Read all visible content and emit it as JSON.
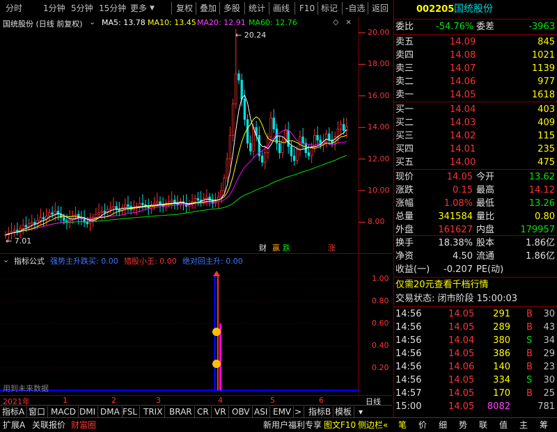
{
  "toolbar": {
    "left_items": [
      "分时",
      "1分钟",
      "5分钟",
      "15分钟",
      "更多"
    ],
    "right_items": [
      "复权",
      "叠加",
      "多股",
      "统计",
      "画线",
      "F10",
      "-自选",
      "返回"
    ]
  },
  "main_chart": {
    "title": "国统股份 (日线 前复权)",
    "ma5": "MA5: 13.78",
    "ma10": "MA10: 13.45",
    "ma20": "MA20: 12.91",
    "ma60": "MA60: 12.76",
    "high_label": "20.24",
    "low_label": "7.01",
    "y_ticks": [
      "20.00",
      "18.00",
      "16.00",
      "14.00",
      "12.00",
      "10.00",
      "8.00"
    ],
    "markers": {
      "cai": "财",
      "ying": "赢",
      "die": "跌",
      "zhang": "涨"
    },
    "colors": {
      "ma5": "#ffffff",
      "ma10": "#ffff00",
      "ma20": "#ff00ff",
      "ma60": "#00ff00",
      "up": "#ff3232",
      "down": "#00ffff"
    }
  },
  "indicator": {
    "title": "指标公式",
    "s1": "强势主升跌买: 0.00",
    "s2": "猎股小王: 0.00",
    "s3": "绝对回主升: 0.00",
    "watermark": "用到未来数据",
    "y_ticks": [
      "1.00",
      "0.80",
      "0.60",
      "0.40",
      "0.20"
    ]
  },
  "axis": {
    "year": "2021年",
    "months": [
      "1",
      "2",
      "3",
      "4",
      "5",
      "6"
    ],
    "period": "日线"
  },
  "tabs": [
    "指标A",
    "窗口",
    "MACD",
    "DMI",
    "DMA",
    "FSL",
    "TRIX",
    "BRAR",
    "CR",
    "VR",
    "OBV",
    "ASI",
    "EMV",
    ">",
    "指标B",
    "模板"
  ],
  "bottom": {
    "left": [
      "扩展A",
      "关联报价",
      "财富圈"
    ],
    "promo": "新用户福利专享",
    "f10": "图文F10",
    "sidebar": "侧边栏",
    "right": [
      "笔",
      "价",
      "细",
      "势",
      "联",
      "值",
      "主",
      "筹"
    ]
  },
  "quote": {
    "code": "002205",
    "name": "国统股份",
    "weibi_label": "委比",
    "weibi": "-54.76%",
    "weicha_label": "委差",
    "weicha": "-3963",
    "asks": [
      {
        "label": "卖五",
        "price": "14.09",
        "vol": "845"
      },
      {
        "label": "卖四",
        "price": "14.08",
        "vol": "1021"
      },
      {
        "label": "卖三",
        "price": "14.07",
        "vol": "1139"
      },
      {
        "label": "卖二",
        "price": "14.06",
        "vol": "977"
      },
      {
        "label": "卖一",
        "price": "14.05",
        "vol": "1618"
      }
    ],
    "bids": [
      {
        "label": "买一",
        "price": "14.04",
        "vol": "403"
      },
      {
        "label": "买二",
        "price": "14.03",
        "vol": "409"
      },
      {
        "label": "买三",
        "price": "14.02",
        "vol": "115"
      },
      {
        "label": "买四",
        "price": "14.01",
        "vol": "235"
      },
      {
        "label": "买五",
        "price": "14.00",
        "vol": "475"
      }
    ],
    "stats": [
      {
        "l1": "现价",
        "v1": "14.05",
        "l2": "今开",
        "v2": "13.62"
      },
      {
        "l1": "涨跌",
        "v1": "0.15",
        "l2": "最高",
        "v2": "14.12"
      },
      {
        "l1": "涨幅",
        "v1": "1.08%",
        "l2": "最低",
        "v2": "13.26"
      },
      {
        "l1": "总量",
        "v1": "341584",
        "l2": "量比",
        "v2": "0.80"
      },
      {
        "l1": "外盘",
        "v1": "161627",
        "l2": "内盘",
        "v2": "179957"
      }
    ],
    "stats2": [
      {
        "l1": "换手",
        "v1": "18.38%",
        "l2": "股本",
        "v2": "1.86亿"
      },
      {
        "l1": "净资",
        "v1": "4.50",
        "l2": "流通",
        "v2": "1.86亿"
      },
      {
        "l1": "收益(一)",
        "v1": "-0.207",
        "l2": "PE(动)",
        "v2": ""
      }
    ],
    "promo": "仅需20元查看千档行情",
    "trade_status": "交易状态: 闭市阶段 15:00:03",
    "ticks": [
      {
        "t": "14:56",
        "p": "14.05",
        "v": "291",
        "d": "B",
        "n": "30"
      },
      {
        "t": "14:56",
        "p": "14.05",
        "v": "289",
        "d": "B",
        "n": "43"
      },
      {
        "t": "14:56",
        "p": "14.04",
        "v": "380",
        "d": "S",
        "n": "34"
      },
      {
        "t": "14:56",
        "p": "14.05",
        "v": "386",
        "d": "B",
        "n": "29"
      },
      {
        "t": "14:56",
        "p": "14.06",
        "v": "140",
        "d": "B",
        "n": "23"
      },
      {
        "t": "14:56",
        "p": "14.05",
        "v": "334",
        "d": "S",
        "n": "30"
      },
      {
        "t": "14:57",
        "p": "14.05",
        "v": "170",
        "d": "B",
        "n": "25"
      },
      {
        "t": "15:00",
        "p": "14.05",
        "v": "8082",
        "d": "",
        "n": "781"
      }
    ]
  }
}
